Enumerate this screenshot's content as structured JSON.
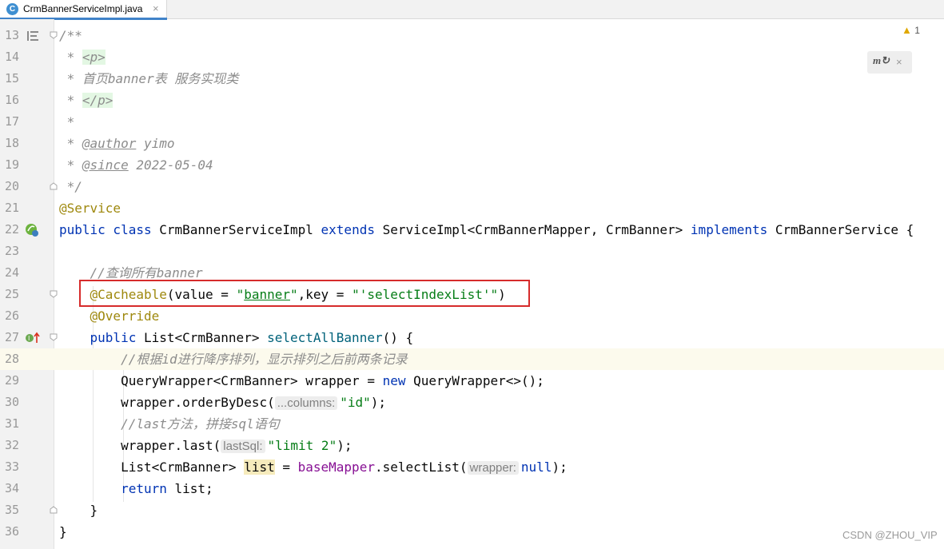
{
  "tab": {
    "icon_letter": "C",
    "title": "CrmBannerServiceImpl.java",
    "close": "×"
  },
  "inspection": {
    "count": "1",
    "icon": "warning-triangle-icon"
  },
  "maven_popup": {
    "icon": "maven-reload-icon",
    "close": "×"
  },
  "line_numbers": [
    "13",
    "14",
    "15",
    "16",
    "17",
    "18",
    "19",
    "20",
    "21",
    "22",
    "23",
    "24",
    "25",
    "26",
    "27",
    "28",
    "29",
    "30",
    "31",
    "32",
    "33",
    "34",
    "35",
    "36"
  ],
  "code": {
    "l13": "/**",
    "l14_star": " * ",
    "l14_tag": "<p>",
    "l15": " * 首页banner表 服务实现类",
    "l16_star": " * ",
    "l16_tag": "</p>",
    "l17": " *",
    "l18_star": " * ",
    "l18_tag": "@author",
    "l18_rest": " yimo",
    "l19_star": " * ",
    "l19_tag": "@since",
    "l19_rest": " 2022-05-04",
    "l20": " */",
    "l21": "@Service",
    "l22_public": "public",
    "l22_class": " class ",
    "l22_name": "CrmBannerServiceImpl ",
    "l22_extends": "extends",
    "l22_super": " ServiceImpl<CrmBannerMapper, CrmBanner> ",
    "l22_implements": "implements",
    "l22_iface": " CrmBannerService {",
    "l24": "    //查询所有banner",
    "l25_indent": "    ",
    "l25_ann": "@Cacheable",
    "l25_a": "(value = ",
    "l25_q1": "\"",
    "l25_v1": "banner",
    "l25_q2": "\"",
    "l25_b": ",key = ",
    "l25_v2": "\"'selectIndexList'\"",
    "l25_c": ")",
    "l26": "    @Override",
    "l27_indent": "    ",
    "l27_public": "public",
    "l27_type": " List<CrmBanner> ",
    "l27_method": "selectAllBanner",
    "l27_rest": "() {",
    "l28": "        //根据id进行降序排列，显示排列之后前两条记录",
    "l29_a": "        QueryWrapper<CrmBanner> wrapper = ",
    "l29_new": "new",
    "l29_b": " QueryWrapper<>();",
    "l30_a": "        wrapper.orderByDesc(",
    "l30_hint": "...columns:",
    "l30_str": "\"id\"",
    "l30_b": ");",
    "l31": "        //last方法，拼接sql语句",
    "l32_a": "        wrapper.last(",
    "l32_hint": "lastSql:",
    "l32_str": "\"limit 2\"",
    "l32_b": ");",
    "l33_a": "        List<CrmBanner> ",
    "l33_var": "list",
    "l33_b": " = ",
    "l33_field": "baseMapper",
    "l33_c": ".selectList(",
    "l33_hint": "wrapper:",
    "l33_null": "null",
    "l33_d": ");",
    "l34_a": "        ",
    "l34_return": "return",
    "l34_b": " list;",
    "l35": "    }",
    "l36": "}"
  },
  "watermark": "CSDN @ZHOU_VIP",
  "colors": {
    "keyword": "#0033b3",
    "annotation": "#9e880d",
    "string": "#067d17",
    "comment": "#8c8c8c",
    "method": "#00627a",
    "field": "#871094",
    "highlight_box": "#d62b2b"
  }
}
